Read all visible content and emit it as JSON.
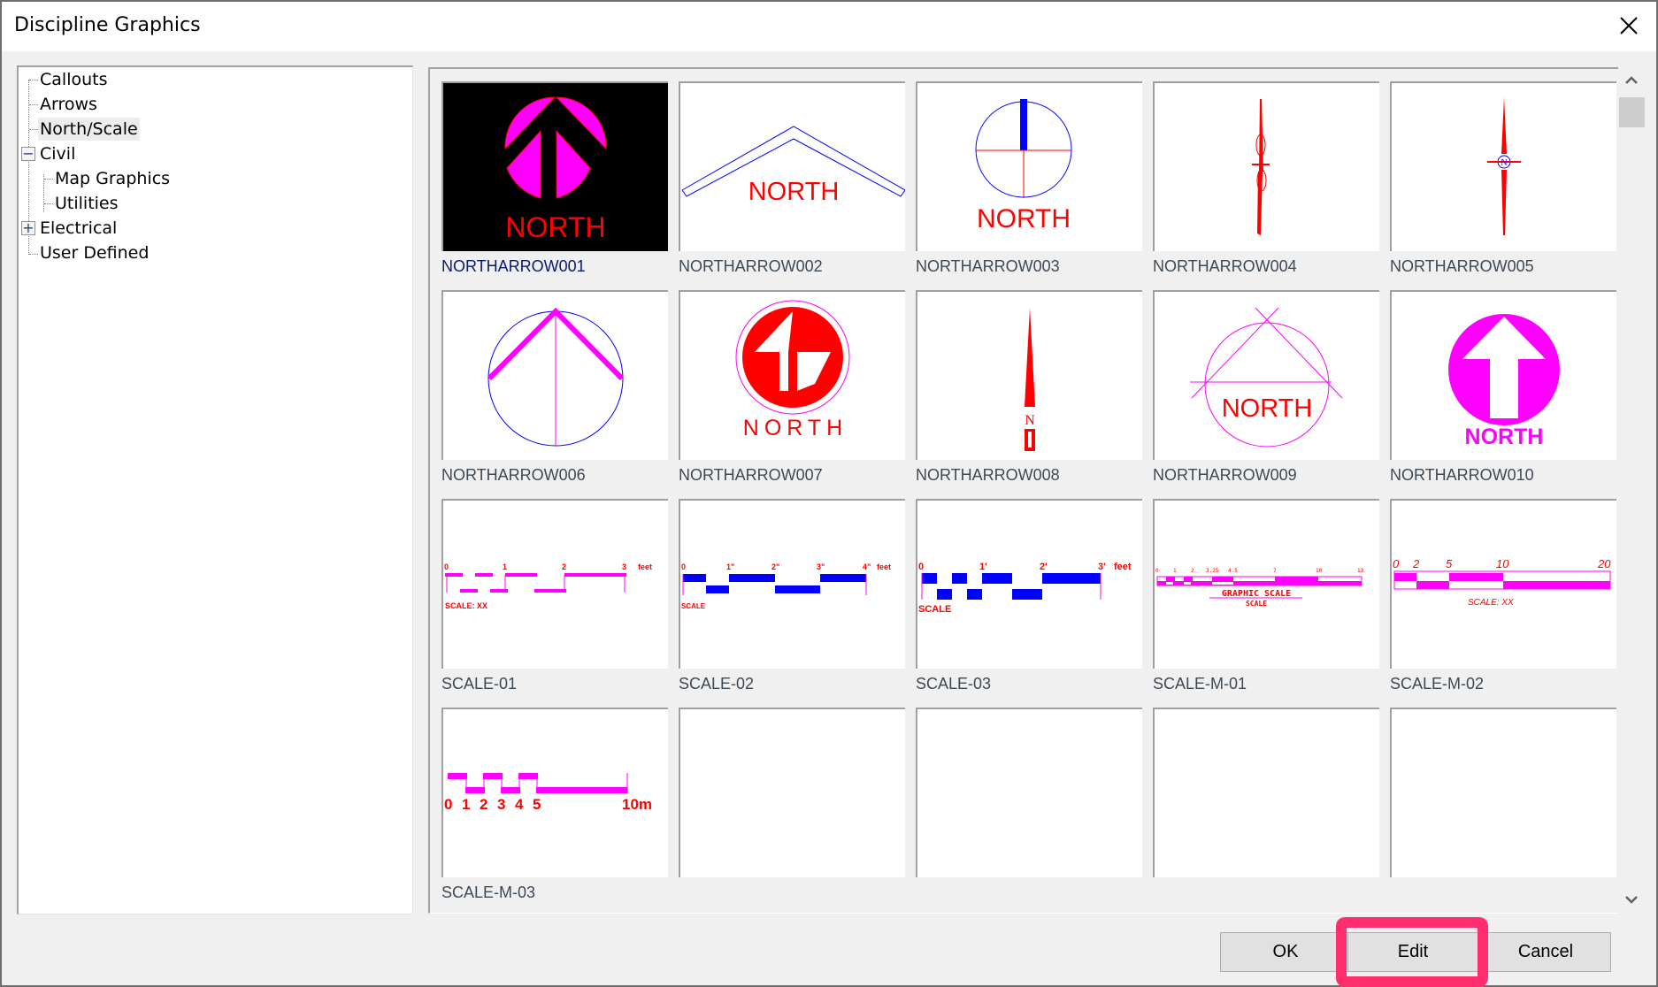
{
  "window": {
    "title": "Discipline Graphics",
    "close_icon": "close-icon"
  },
  "tree": {
    "items": [
      {
        "label": "Callouts",
        "level": 0,
        "expander": null,
        "selected": false
      },
      {
        "label": "Arrows",
        "level": 0,
        "expander": null,
        "selected": false
      },
      {
        "label": "North/Scale",
        "level": 0,
        "expander": null,
        "selected": true
      },
      {
        "label": "Civil",
        "level": 0,
        "expander": "−",
        "selected": false
      },
      {
        "label": "Map Graphics",
        "level": 1,
        "expander": null,
        "selected": false
      },
      {
        "label": "Utilities",
        "level": 1,
        "expander": null,
        "selected": false
      },
      {
        "label": "Electrical",
        "level": 0,
        "expander": "+",
        "selected": false
      },
      {
        "label": "User Defined",
        "level": 0,
        "expander": null,
        "selected": false
      }
    ]
  },
  "gallery": {
    "selected": "NORTHARROW001",
    "items": [
      {
        "name": "NORTHARROW001",
        "north_text": "NORTH"
      },
      {
        "name": "NORTHARROW002",
        "north_text": "NORTH"
      },
      {
        "name": "NORTHARROW003",
        "north_text": "NORTH"
      },
      {
        "name": "NORTHARROW004"
      },
      {
        "name": "NORTHARROW005",
        "center_text": "N"
      },
      {
        "name": "NORTHARROW006"
      },
      {
        "name": "NORTHARROW007",
        "north_text": "NORTH"
      },
      {
        "name": "NORTHARROW008",
        "center_text": "N"
      },
      {
        "name": "NORTHARROW009",
        "north_text": "NORTH"
      },
      {
        "name": "NORTHARROW010",
        "north_text": "NORTH"
      },
      {
        "name": "SCALE-01",
        "ticks": [
          "0",
          "1",
          "2",
          "3"
        ],
        "unit": "feet",
        "caption": "SCALE: XX"
      },
      {
        "name": "SCALE-02",
        "ticks": [
          "0",
          "1\"",
          "2\"",
          "3\"",
          "4\""
        ],
        "unit": "feet",
        "caption": "SCALE"
      },
      {
        "name": "SCALE-03",
        "ticks": [
          "0",
          "1'",
          "2'",
          "3'"
        ],
        "unit": "feet",
        "caption": "SCALE"
      },
      {
        "name": "SCALE-M-01",
        "ticks": [
          "0",
          "1",
          "2",
          "3.25",
          "4.5",
          "7",
          "10",
          "13"
        ],
        "caption": "GRAPHIC SCALE",
        "subcaption": "SCALE"
      },
      {
        "name": "SCALE-M-02",
        "ticks": [
          "0",
          "2",
          "5",
          "10",
          "20"
        ],
        "caption": "SCALE: XX"
      },
      {
        "name": "SCALE-M-03",
        "ticks": [
          "0",
          "1",
          "2",
          "3",
          "4",
          "5",
          "10m"
        ]
      },
      {
        "name": ""
      },
      {
        "name": ""
      },
      {
        "name": ""
      },
      {
        "name": ""
      }
    ]
  },
  "scrollbar": {
    "up_icon": "chevron-up-icon",
    "down_icon": "chevron-down-icon",
    "position": 0
  },
  "buttons": {
    "ok": "OK",
    "edit": "Edit",
    "cancel": "Cancel"
  },
  "annotation": {
    "highlighted": "Edit",
    "color": "#ff2d6e"
  },
  "colors": {
    "magenta": "#ff00ff",
    "red": "#ff0000",
    "blue": "#0000ff"
  }
}
